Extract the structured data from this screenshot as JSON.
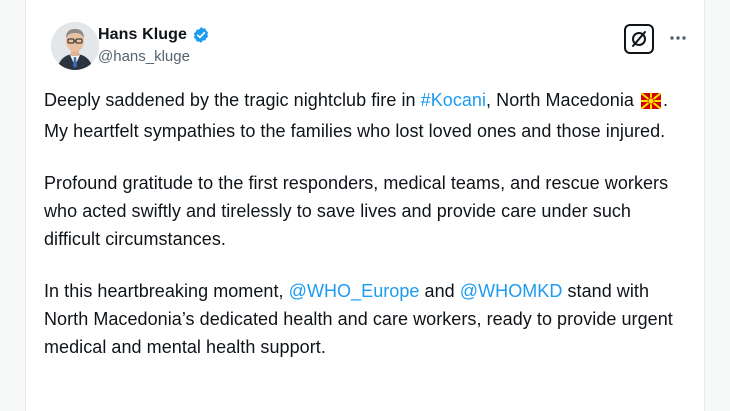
{
  "author": {
    "name": "Hans Kluge",
    "handle": "@hans_kluge",
    "verified_color": "#1d9bf0"
  },
  "actions": {
    "grok_icon": "grok-icon",
    "more_label": "···"
  },
  "tweet": {
    "p1_a": "Deeply saddened by the tragic nightclub fire in ",
    "p1_tag": "#Kocani",
    "p1_b": ", North Macedonia ",
    "p1_flag": "north-macedonia-flag",
    "p1_c": ". My heartfelt sympathies to the families who lost loved ones and those injured.",
    "p2": "Profound gratitude to the first responders, medical teams, and rescue workers who acted swiftly and tirelessly to save lives and provide care under such difficult circumstances.",
    "p3_a": "In this heartbreaking moment, ",
    "p3_m1": "@WHO_Europe",
    "p3_b": " and ",
    "p3_m2": "@WHOMKD",
    "p3_c": " stand with North Macedonia’s dedicated health and care workers, ready to provide urgent medical and mental health support."
  },
  "colors": {
    "link": "#1d9bf0",
    "text": "#0f1419",
    "muted": "#536471"
  }
}
